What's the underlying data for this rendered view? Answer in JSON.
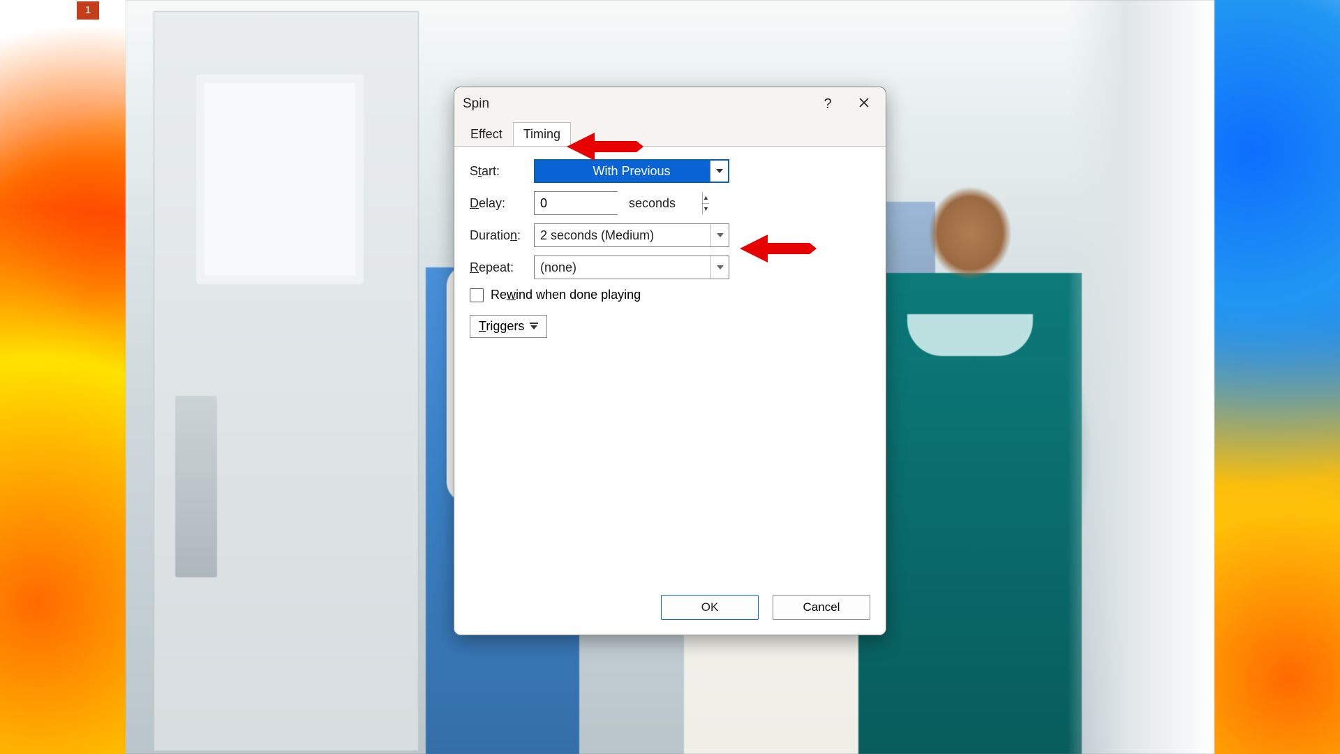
{
  "slide": {
    "number": "1"
  },
  "dialog": {
    "title": "Spin",
    "help_symbol": "?",
    "tabs": {
      "effect": "Effect",
      "timing": "Timing"
    },
    "timing": {
      "start": {
        "label_pre": "S",
        "label_u": "t",
        "label_post": "art:",
        "value": "With Previous"
      },
      "delay": {
        "label_pre": "",
        "label_u": "D",
        "label_post": "elay:",
        "value": "0",
        "suffix": "seconds"
      },
      "duration": {
        "label_pre": "Duratio",
        "label_u": "n",
        "label_post": ":",
        "value": "2 seconds (Medium)"
      },
      "repeat": {
        "label_pre": "",
        "label_u": "R",
        "label_post": "epeat:",
        "value": "(none)"
      },
      "rewind": {
        "label_pre": "Re",
        "label_u": "w",
        "label_post": "ind when done playing",
        "checked": false
      },
      "triggers": {
        "label_pre": "",
        "label_u": "T",
        "label_post": "riggers"
      }
    },
    "buttons": {
      "ok": "OK",
      "cancel": "Cancel"
    }
  }
}
